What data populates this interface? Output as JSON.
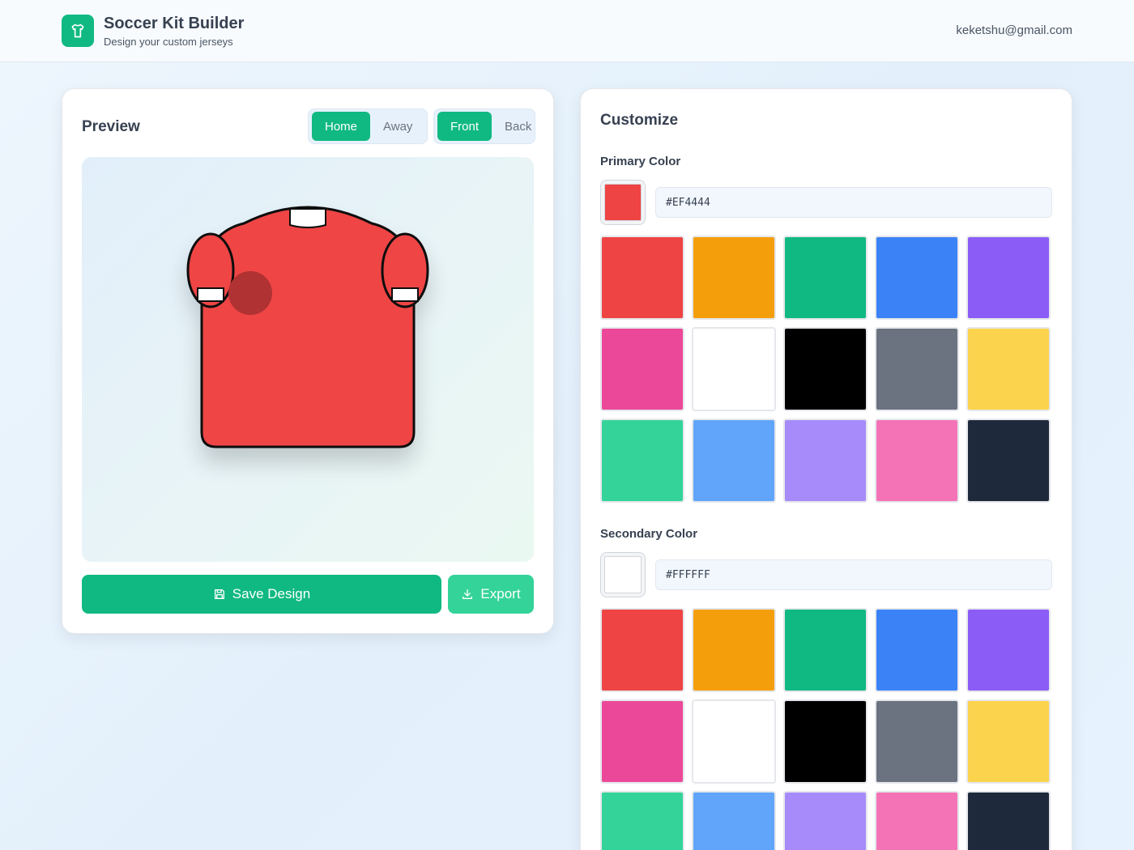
{
  "header": {
    "title": "Soccer Kit Builder",
    "subtitle": "Design your custom jerseys",
    "user_email": "keketshu@gmail.com",
    "logo_icon": "shirt-icon"
  },
  "preview": {
    "title": "Preview",
    "kit_toggle": {
      "options": [
        "Home",
        "Away"
      ],
      "selected": "Home"
    },
    "view_toggle": {
      "options": [
        "Front",
        "Back"
      ],
      "selected": "Front"
    },
    "jersey": {
      "primary_color": "#EF4444",
      "secondary_color": "#FFFFFF",
      "badge_color": "#B03030",
      "outline_color": "#111111"
    },
    "save_label": "Save Design",
    "save_icon": "save-icon",
    "export_label": "Export",
    "export_icon": "download-icon"
  },
  "customize": {
    "title": "Customize",
    "primary": {
      "label": "Primary Color",
      "value": "#EF4444",
      "swatches": [
        "#EF4444",
        "#F59E0B",
        "#10B981",
        "#3B82F6",
        "#8B5CF6",
        "#EC4899",
        "#FFFFFF",
        "#000000",
        "#6B7280",
        "#FCD34D",
        "#34D399",
        "#60A5FA",
        "#A78BFA",
        "#F472B6",
        "#1E293B"
      ]
    },
    "secondary": {
      "label": "Secondary Color",
      "value": "#FFFFFF",
      "swatches": [
        "#EF4444",
        "#F59E0B",
        "#10B981",
        "#3B82F6",
        "#8B5CF6",
        "#EC4899",
        "#FFFFFF",
        "#000000",
        "#6B7280",
        "#FCD34D",
        "#34D399",
        "#60A5FA",
        "#A78BFA",
        "#F472B6",
        "#1E293B"
      ]
    }
  }
}
